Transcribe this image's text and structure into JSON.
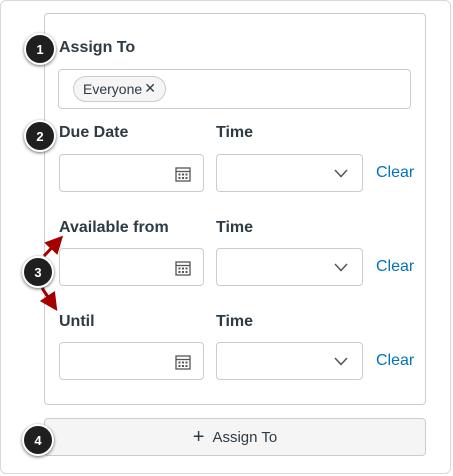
{
  "assign_to": {
    "label": "Assign To",
    "assignees": [
      {
        "name": "Everyone",
        "remove_icon": "close-icon"
      }
    ]
  },
  "due_date": {
    "label": "Due Date",
    "time_label": "Time",
    "clear_label": "Clear",
    "date_value": "",
    "time_value": ""
  },
  "available_from": {
    "label": "Available from",
    "time_label": "Time",
    "clear_label": "Clear",
    "date_value": "",
    "time_value": ""
  },
  "until": {
    "label": "Until",
    "time_label": "Time",
    "clear_label": "Clear",
    "date_value": "",
    "time_value": ""
  },
  "add_assign": {
    "label": "Assign To",
    "icon": "plus-icon"
  },
  "callouts": [
    "1",
    "2",
    "3",
    "4"
  ],
  "colors": {
    "link": "#0374b5",
    "text": "#2d3b45",
    "border": "#c7cdd1",
    "arrow": "#a50000",
    "badge": "#1f1f1f"
  }
}
